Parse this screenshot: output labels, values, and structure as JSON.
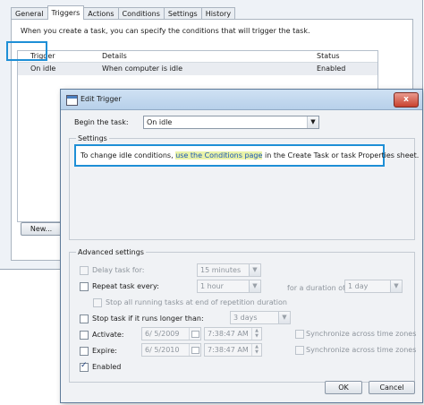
{
  "back_dialog": {
    "tabs": [
      {
        "label": "General"
      },
      {
        "label": "Triggers",
        "active": true
      },
      {
        "label": "Actions"
      },
      {
        "label": "Conditions"
      },
      {
        "label": "Settings"
      },
      {
        "label": "History"
      }
    ],
    "description": "When you create a task, you can specify the conditions that will trigger the task.",
    "columns": {
      "trigger": "Trigger",
      "details": "Details",
      "status": "Status"
    },
    "rows": [
      {
        "trigger": "On idle",
        "details": "When computer is idle",
        "status": "Enabled"
      }
    ],
    "new_button": "New..."
  },
  "edit_trigger": {
    "title": "Edit Trigger",
    "close_glyph": "x",
    "begin_label": "Begin the task:",
    "begin_value": "On idle",
    "settings_title": "Settings",
    "info_prefix": "To change idle conditions, ",
    "info_link": "use the Conditions page",
    "info_suffix": " in the Create Task or task Properties sheet.",
    "advanced_title": "Advanced settings",
    "delay_label": "Delay task for:",
    "delay_value": "15 minutes",
    "repeat_label": "Repeat task every:",
    "repeat_value": "1 hour",
    "duration_label": "for a duration of:",
    "duration_value": "1 day",
    "stop_all_label": "Stop all running tasks at end of repetition duration",
    "stop_if_label": "Stop task if it runs longer than:",
    "stop_if_value": "3 days",
    "activate_label": "Activate:",
    "activate_date": "6/ 5/2009",
    "activate_time": "7:38:47 AM",
    "expire_label": "Expire:",
    "expire_date": "6/ 5/2010",
    "expire_time": "7:38:47 AM",
    "sync_label_1": "Synchronize across time zones",
    "sync_label_2": "Synchronize across time zones",
    "enabled_label": "Enabled",
    "ok_label": "OK",
    "cancel_label": "Cancel"
  },
  "colors": {
    "highlight_border": "#1e8fd6",
    "link": "#1a56b5",
    "link_highlight": "#eaf3a8"
  }
}
